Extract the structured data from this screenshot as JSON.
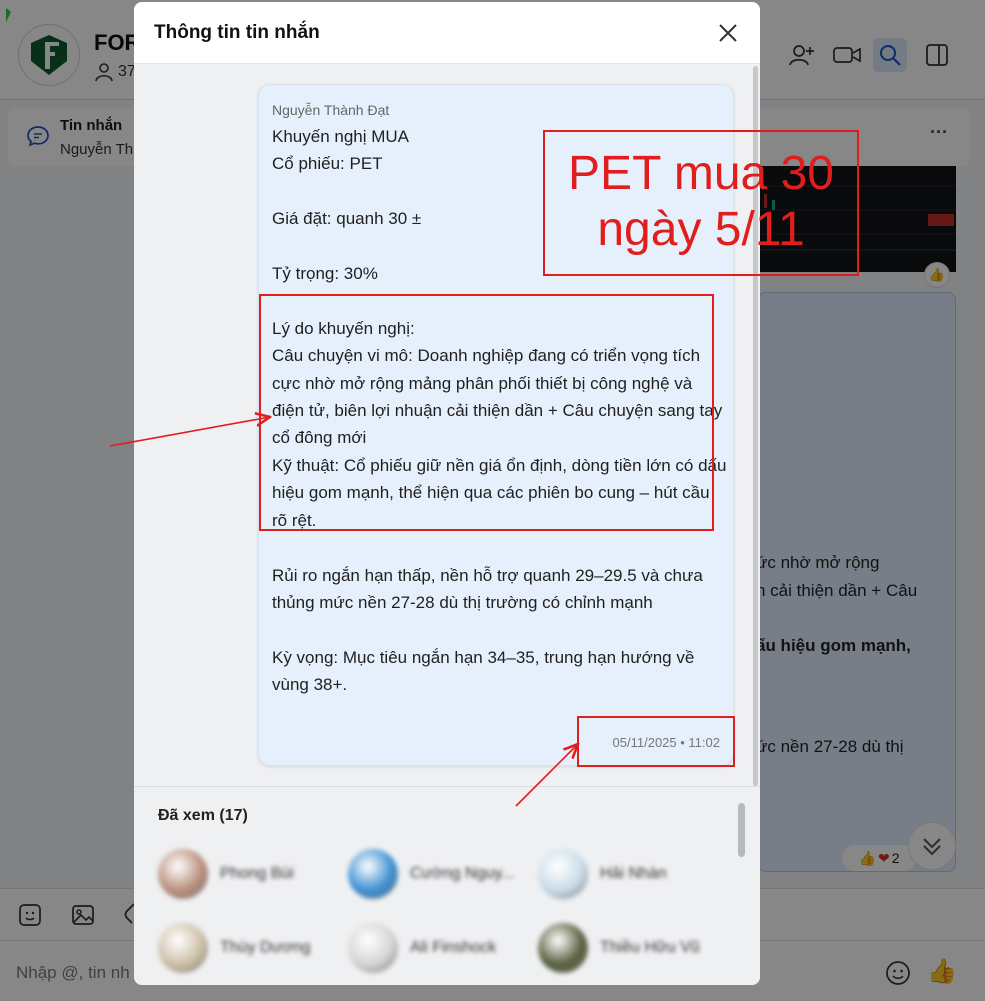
{
  "app": {
    "group_name": "FOR",
    "member_count": "37",
    "pinned": {
      "title": "Tin nhắn",
      "subtitle": "Nguyễn Th",
      "more": "···"
    },
    "background_message_fragments": [
      "ức nhờ mở rộng",
      "n cải thiện dần + Câu",
      "ấu hiệu gom mạnh,",
      "ức nền 27-28 dù thị"
    ],
    "reactions": {
      "count": "2"
    },
    "input": {
      "placeholder": "Nhập @, tin nh"
    },
    "icons": {
      "add_member": "add-member-icon",
      "video": "video-camera-icon",
      "search": "search-icon",
      "sidebar": "sidebar-toggle-icon",
      "emoji": "emoji-icon",
      "image": "image-icon",
      "like": "thumbs-up-icon"
    }
  },
  "modal": {
    "title": "Thông tin tin nhắn",
    "message": {
      "sender": "Nguyễn Thành Đạt",
      "text": "Khuyến nghị MUA\nCổ phiếu: PET\n\nGiá đặt: quanh 30 ±\n\nTỷ trọng: 30%\n\nLý do khuyến nghị:\nCâu chuyện vi mô: Doanh nghiệp đang có triển vọng tích cực nhờ mở rộng mảng phân phối thiết bị công nghệ và điện tử, biên lợi nhuận cải thiện dần + Câu chuyện sang tay cổ đông mới\nKỹ thuật: Cổ phiếu giữ nền giá ổn định, dòng tiền lớn có dấu hiệu gom mạnh, thể hiện qua các phiên bo cung – hút cầu rõ rệt.\n\nRủi ro ngắn hạn thấp, nền hỗ trợ quanh 29–29.5 và chưa thủng mức nền 27-28 dù thị trường có chỉnh mạnh\n\nKỳ vọng: Mục tiêu ngắn hạn 34–35, trung hạn hướng về vùng 38+.",
      "timestamp": "05/11/2025 • 11:02"
    },
    "seen": {
      "title": "Đã xem (17)",
      "viewers": [
        {
          "name": "Phong Bùi",
          "color": "#b98f7c"
        },
        {
          "name": "Cường Nguy...",
          "color": "#3d8fd3"
        },
        {
          "name": "Hải Nhàn",
          "color": "#c9dce8"
        },
        {
          "name": "Thùy Dương",
          "color": "#cdbfa7"
        },
        {
          "name": "Ali Finshock",
          "color": "#d4d4d4"
        },
        {
          "name": "Thiều Hữu Vũ",
          "color": "#58603e"
        }
      ]
    }
  },
  "annotation": {
    "line1": "PET mua 30",
    "line2": "ngày 5/11",
    "color": "#e01e1e"
  }
}
